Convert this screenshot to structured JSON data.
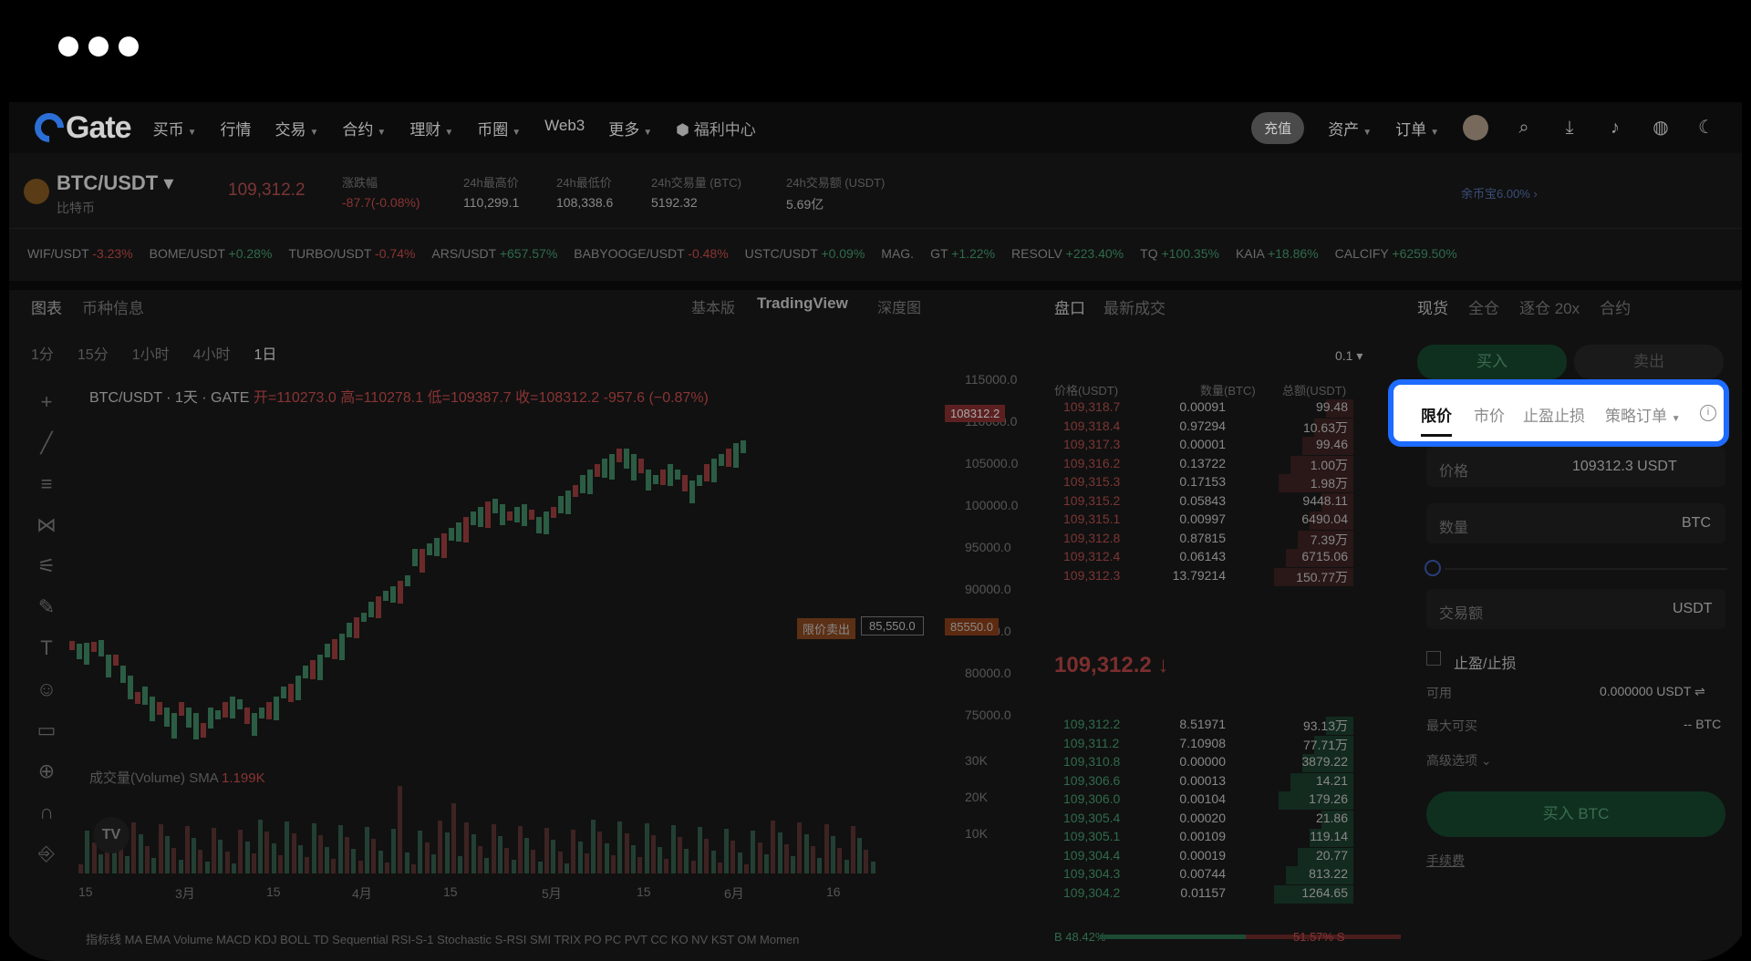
{
  "nav": {
    "logo": "Gate",
    "items": [
      "买币",
      "行情",
      "交易",
      "合约",
      "理财",
      "币圈",
      "Web3",
      "更多"
    ],
    "has_caret": [
      true,
      false,
      true,
      true,
      true,
      true,
      false,
      true
    ],
    "promo": "福利中心",
    "deposit": "充值",
    "assets": "资产",
    "orders": "订单"
  },
  "ticker": {
    "pair": "BTC/USDT",
    "sub": "比特币",
    "price": "109,312.2",
    "change_label": "涨跌幅",
    "change": "-87.7(-0.08%)",
    "high_label": "24h最高价",
    "high": "110,299.1",
    "low_label": "24h最低价",
    "low": "108,338.6",
    "vol_label": "24h交易量 (BTC)",
    "vol": "5192.32",
    "amt_label": "24h交易额 (USDT)",
    "amt": "5.69亿",
    "promo": "余币宝6.00%"
  },
  "marquee": [
    [
      "WIF/USDT",
      "-3.23%"
    ],
    [
      "BOME/USDT",
      "+0.28%"
    ],
    [
      "TURBO/USDT",
      "-0.74%"
    ],
    [
      "ARS/USDT",
      "+657.57%"
    ],
    [
      "BABYOOGE/USDT",
      "-0.48%"
    ],
    [
      "USTC/USDT",
      "+0.09%"
    ],
    [
      "MAG.",
      ""
    ],
    [
      "GT",
      "+1.22%"
    ],
    [
      "RESOLV",
      "+223.40%"
    ],
    [
      "TQ",
      "+100.35%"
    ],
    [
      "KAIA",
      "+18.86%"
    ],
    [
      "CALCIFY",
      "+6259.50%"
    ]
  ],
  "chart": {
    "tab1": "图表",
    "tab2": "币种信息",
    "view_basic": "基本版",
    "view_tv": "TradingView",
    "view_depth": "深度图",
    "intervals": [
      "1分",
      "15分",
      "1小时",
      "4小时",
      "1日"
    ],
    "legend": "BTC/USDT · 1天 · GATE",
    "o": "开=110273.0",
    "h": "高=110278.1",
    "l": "低=109387.7",
    "c": "收=108312.2",
    "chg": "-957.6 (−0.87%)",
    "price_tag": "108312.2",
    "cross_tag": "限价卖出",
    "cross_val": "85,550.0",
    "ticks": [
      "115000.0",
      "110000.0",
      "105000.0",
      "100000.0",
      "95000.0",
      "90000.0",
      "85000.0",
      "80000.0",
      "75000.0"
    ],
    "vol_ticks": [
      "30K",
      "20K",
      "10K"
    ],
    "volume_legend": "成交量(Volume) SMA",
    "volume_val": "1.199K",
    "xlabels": [
      "15",
      "3月",
      "15",
      "4月",
      "15",
      "5月",
      "15",
      "6月",
      "16"
    ],
    "indicators": "指标线 MA EMA Volume MACD KDJ BOLL TD Sequential RSI-S-1 Stochastic S-RSI SMI TRIX PO PC PVT CC KO NV KST OM Momen"
  },
  "orderbook": {
    "tab1": "盘口",
    "tab2": "最新成交",
    "precision": "0.1",
    "h_price": "价格(USDT)",
    "h_qty": "数量(BTC)",
    "h_total": "总额(USDT)",
    "asks": [
      [
        "109,318.7",
        "0.00091",
        "99.48"
      ],
      [
        "109,318.4",
        "0.97294",
        "10.63万"
      ],
      [
        "109,317.3",
        "0.00001",
        "99.46"
      ],
      [
        "109,316.2",
        "0.13722",
        "1.00万"
      ],
      [
        "109,315.3",
        "0.17153",
        "1.98万"
      ],
      [
        "109,315.2",
        "0.05843",
        "9448.11"
      ],
      [
        "109,315.1",
        "0.00997",
        "6490.04"
      ],
      [
        "109,312.8",
        "0.87815",
        "7.39万"
      ],
      [
        "109,312.4",
        "0.06143",
        "6715.06"
      ],
      [
        "109,312.3",
        "13.79214",
        "150.77万"
      ]
    ],
    "last": "109,312.2",
    "bids": [
      [
        "109,312.2",
        "8.51971",
        "93.13万"
      ],
      [
        "109,311.2",
        "7.10908",
        "77.71万"
      ],
      [
        "109,310.8",
        "0.00000",
        "3879.22"
      ],
      [
        "109,306.6",
        "0.00013",
        "14.21"
      ],
      [
        "109,306.0",
        "0.00104",
        "179.26"
      ],
      [
        "109,305.4",
        "0.00020",
        "21.86"
      ],
      [
        "109,305.1",
        "0.00109",
        "119.14"
      ],
      [
        "109,304.4",
        "0.00019",
        "20.77"
      ],
      [
        "109,304.3",
        "0.00744",
        "813.22"
      ],
      [
        "109,304.2",
        "0.01157",
        "1264.65"
      ]
    ],
    "buy_pct": "B 48.42%",
    "sell_pct": "51.57% S"
  },
  "trade": {
    "tabs": [
      "现货",
      "全仓",
      "逐仓 20x",
      "合约"
    ],
    "buy": "买入",
    "sell": "卖出",
    "order_tabs": [
      "限价",
      "市价",
      "止盈止损",
      "策略订单"
    ],
    "price_label": "价格",
    "price_val": "109312.3 USDT",
    "amount_label": "数量",
    "amount_unit": "BTC",
    "total_label": "交易额",
    "total_unit": "USDT",
    "tpsl": "止盈/止损",
    "avail_label": "可用",
    "avail": "0.000000 USDT",
    "max_label": "最大可买",
    "max": "-- BTC",
    "advanced": "高级选项",
    "submit": "买入 BTC",
    "fee": "手续费"
  }
}
